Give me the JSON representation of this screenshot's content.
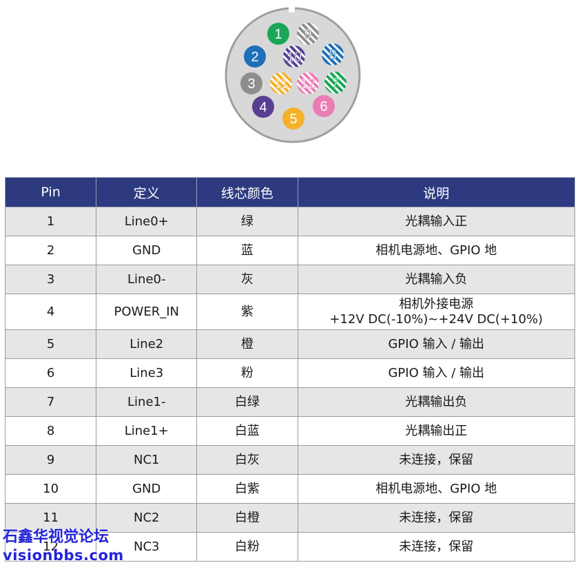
{
  "connector": {
    "pins": [
      {
        "label": "1",
        "color": "#1aa656",
        "striped": false
      },
      {
        "label": "2",
        "color": "#1e6fb8",
        "striped": false
      },
      {
        "label": "3",
        "color": "#8e8e8e",
        "striped": false
      },
      {
        "label": "4",
        "color": "#583f92",
        "striped": false
      },
      {
        "label": "5",
        "color": "#f4b12a",
        "striped": false
      },
      {
        "label": "6",
        "color": "#ea7db6",
        "striped": false
      },
      {
        "label": "7",
        "color": "#1aa656",
        "striped": true
      },
      {
        "label": "8",
        "color": "#1e6fb8",
        "striped": true
      },
      {
        "label": "9",
        "color": "#8e8e8e",
        "striped": true
      },
      {
        "label": "10",
        "color": "#583f92",
        "striped": true
      },
      {
        "label": "11",
        "color": "#f4b12a",
        "striped": true
      },
      {
        "label": "12",
        "color": "#ea7db6",
        "striped": true
      }
    ],
    "shell_color": "#d8d8d8",
    "rim_color": "#9f9f9f"
  },
  "table": {
    "headers": [
      "Pin",
      "定义",
      "线芯颜色",
      "说明"
    ],
    "header_bg": "#2d3a80",
    "rows": [
      {
        "pin": "1",
        "def": "Line0+",
        "color": "绿",
        "desc": "光耦输入正"
      },
      {
        "pin": "2",
        "def": "GND",
        "color": "蓝",
        "desc": "相机电源地、GPIO 地"
      },
      {
        "pin": "3",
        "def": "Line0-",
        "color": "灰",
        "desc": "光耦输入负"
      },
      {
        "pin": "4",
        "def": "POWER_IN",
        "color": "紫",
        "desc": "相机外接电源",
        "desc2": "+12V DC(-10%)~+24V DC(+10%)"
      },
      {
        "pin": "5",
        "def": "Line2",
        "color": "橙",
        "desc": "GPIO 输入 / 输出"
      },
      {
        "pin": "6",
        "def": "Line3",
        "color": "粉",
        "desc": "GPIO 输入 / 输出"
      },
      {
        "pin": "7",
        "def": "Line1-",
        "color": "白绿",
        "desc": "光耦输出负"
      },
      {
        "pin": "8",
        "def": "Line1+",
        "color": "白蓝",
        "desc": "光耦输出正"
      },
      {
        "pin": "9",
        "def": "NC1",
        "color": "白灰",
        "desc": "未连接，保留"
      },
      {
        "pin": "10",
        "def": "GND",
        "color": "白紫",
        "desc": "相机电源地、GPIO 地"
      },
      {
        "pin": "11",
        "def": "NC2",
        "color": "白橙",
        "desc": "未连接，保留"
      },
      {
        "pin": "12",
        "def": "NC3",
        "color": "白粉",
        "desc": "未连接，保留"
      }
    ]
  },
  "watermark": {
    "line1": "石鑫华视觉论坛",
    "line2": "visionbbs.com"
  }
}
